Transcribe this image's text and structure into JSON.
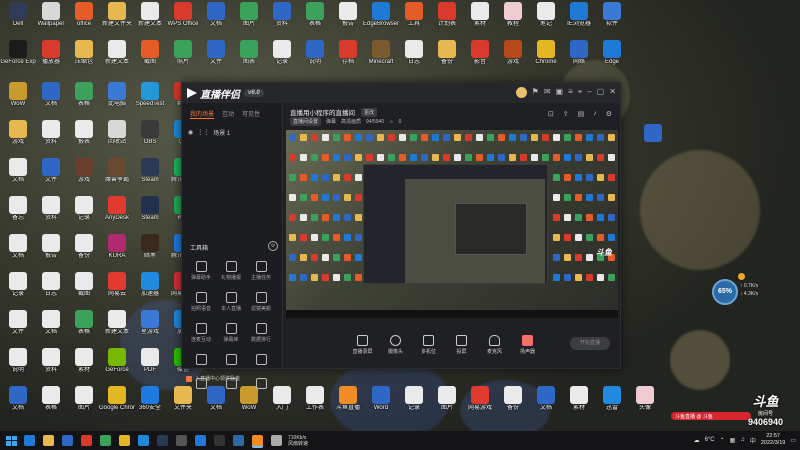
{
  "app": {
    "title_logo": "直播伴侣",
    "version_badge": "v6.0",
    "tabs": [
      "我的场景",
      "互动",
      "可见性"
    ],
    "scene_name": "场景 1",
    "stream_title": "直播用小程序的直播间",
    "stream_tag": "更改",
    "sub_items": [
      "直播间设置",
      "弹幕",
      "高清画质",
      "94/5940",
      "0"
    ],
    "toolbox_title": "工具箱",
    "tools": [
      "弹幕助手",
      "礼物播报",
      "主播任务",
      "拍照语音",
      "本人直播",
      "滤镜美颜",
      "连麦互动",
      "弹幕库",
      "数据排行",
      "",
      "",
      "",
      "",
      "",
      ""
    ],
    "promo_text": "入直播中心领奖励金",
    "controls": [
      "直播录屏",
      "摄像头",
      "多机位",
      "投屏",
      "麦克风",
      "扬声器"
    ],
    "go_live": "开始直播"
  },
  "widget": {
    "percent": "65%",
    "up": "0.7K/s",
    "down": "4.3K/s"
  },
  "watermark": {
    "brand": "斗鱼",
    "roomlabel": "房间号",
    "room_id": "9406940",
    "ticker": "斗鱼直播 @ 斗鱼"
  },
  "taskbar": {
    "speed_line1": "710Kb/s",
    "speed_line2": "风扇转速",
    "temp": "6°C",
    "ime": "中",
    "time": "22:57",
    "date": "2022/3/19"
  },
  "desktop_icons": [
    {
      "label": "Dell",
      "color": "#2f3b57"
    },
    {
      "label": "Wallpaper",
      "color": "#d8d8d8"
    },
    {
      "label": "office",
      "color": "#e55c28"
    },
    {
      "label": "新建文件夹",
      "color": "#e7b84f"
    },
    {
      "label": "新建文本",
      "color": "#eaeaea"
    },
    {
      "label": "WPS Office",
      "color": "#d93a2b"
    },
    {
      "label": "文档",
      "color": "#2e67c5"
    },
    {
      "label": "图片",
      "color": "#3aa25a"
    },
    {
      "label": "资料",
      "color": "#2e67c5"
    },
    {
      "label": "表格",
      "color": "#3aa25a"
    },
    {
      "label": "报告",
      "color": "#eaeaea"
    },
    {
      "label": "EdgeBrowser",
      "color": "#1e7ad6"
    },
    {
      "label": "工具",
      "color": "#e55c28"
    },
    {
      "label": "计划表",
      "color": "#d93a2b"
    },
    {
      "label": "素材",
      "color": "#eaeaea"
    },
    {
      "label": "教程",
      "color": "#f1cbd2"
    },
    {
      "label": "笔记",
      "color": "#eaeaea"
    },
    {
      "label": "IE浏览器",
      "color": "#1e7ad6"
    },
    {
      "label": "软件",
      "color": "#3a79d6"
    },
    {
      "label": "GeForce Exp",
      "color": "#1b1b1b"
    },
    {
      "label": "播放器",
      "color": "#d93a2b"
    },
    {
      "label": "压缩包",
      "color": "#e7b84f"
    },
    {
      "label": "新建文本",
      "color": "#eaeaea"
    },
    {
      "label": "截图",
      "color": "#e55c28"
    },
    {
      "label": "照片",
      "color": "#3aa25a"
    },
    {
      "label": "文件",
      "color": "#2e67c5"
    },
    {
      "label": "图表",
      "color": "#3aa25a"
    },
    {
      "label": "记录",
      "color": "#eaeaea"
    },
    {
      "label": "说明",
      "color": "#2e67c5"
    },
    {
      "label": "存档",
      "color": "#d93a2b"
    },
    {
      "label": "Minecraft",
      "color": "#7a5a2e"
    },
    {
      "label": "日志",
      "color": "#eaeaea"
    },
    {
      "label": "备份",
      "color": "#e7b84f"
    },
    {
      "label": "影音",
      "color": "#d93a2b"
    },
    {
      "label": "游戏",
      "color": "#b8471c"
    },
    {
      "label": "Chrome",
      "color": "#e3b723"
    },
    {
      "label": "网络",
      "color": "#2e67c5"
    },
    {
      "label": "Edge",
      "color": "#1e7ad6"
    },
    {
      "label": "WoW",
      "color": "#c99b2e"
    },
    {
      "label": "文档",
      "color": "#2e67c5"
    },
    {
      "label": "表格",
      "color": "#3aa25a"
    },
    {
      "label": "此电脑",
      "color": "#3a79d6"
    },
    {
      "label": "SpeedTest",
      "color": "#2497d6"
    },
    {
      "label": "群组",
      "color": "#d93a2b"
    },
    {
      "label": "游戏",
      "color": "#e7b84f"
    },
    {
      "label": "资料",
      "color": "#eaeaea"
    },
    {
      "label": "报表",
      "color": "#eaeaea"
    },
    {
      "label": "回收站",
      "color": "#d8d8d8"
    },
    {
      "label": "OBS",
      "color": "#3a3a3a"
    },
    {
      "label": "QQ",
      "color": "#1c8ad8"
    },
    {
      "label": "文档",
      "color": "#eaeaea"
    },
    {
      "label": "文件",
      "color": "#2e67c5"
    },
    {
      "label": "游戏",
      "color": "#6a3f2e"
    },
    {
      "label": "魔兽争霸",
      "color": "#6a4a2e"
    },
    {
      "label": "Steam",
      "color": "#2a3a55"
    },
    {
      "label": "腾讯视频",
      "color": "#1eb35a"
    },
    {
      "label": "备忘",
      "color": "#eaeaea"
    },
    {
      "label": "资料",
      "color": "#eaeaea"
    },
    {
      "label": "记录",
      "color": "#eaeaea"
    },
    {
      "label": "AnyDesk",
      "color": "#e23a2e"
    },
    {
      "label": "Steam",
      "color": "#22324e"
    },
    {
      "label": "视频",
      "color": "#22aa55"
    },
    {
      "label": "文档",
      "color": "#eaeaea"
    },
    {
      "label": "报告",
      "color": "#eaeaea"
    },
    {
      "label": "备份",
      "color": "#eaeaea"
    },
    {
      "label": "KURA",
      "color": "#b02a6d"
    },
    {
      "label": "暗黑",
      "color": "#3a2a1e"
    },
    {
      "label": "腾讯会议",
      "color": "#1f7ae0"
    },
    {
      "label": "记录",
      "color": "#eaeaea"
    },
    {
      "label": "日志",
      "color": "#eaeaea"
    },
    {
      "label": "截图",
      "color": "#eaeaea"
    },
    {
      "label": "网易云",
      "color": "#e23a2e"
    },
    {
      "label": "加速器",
      "color": "#1f8ae0"
    },
    {
      "label": "网易音乐",
      "color": "#d4303a"
    },
    {
      "label": "文件",
      "color": "#eaeaea"
    },
    {
      "label": "文档",
      "color": "#eaeaea"
    },
    {
      "label": "表格",
      "color": "#3aa25a"
    },
    {
      "label": "新建文本",
      "color": "#eaeaea"
    },
    {
      "label": "星游戏",
      "color": "#3a79d6"
    },
    {
      "label": "加速",
      "color": "#1f8ae0"
    },
    {
      "label": "说明",
      "color": "#eaeaea"
    },
    {
      "label": "资料",
      "color": "#eaeaea"
    },
    {
      "label": "素材",
      "color": "#eaeaea"
    },
    {
      "label": "GeForce",
      "color": "#76b900"
    },
    {
      "label": "PDF",
      "color": "#eaeaea"
    },
    {
      "label": "微信",
      "color": "#2dc100"
    },
    {
      "label": "文档",
      "color": "#2e67c5"
    },
    {
      "label": "表格",
      "color": "#eaeaea"
    },
    {
      "label": "图片",
      "color": "#eaeaea"
    },
    {
      "label": "Google Chrome",
      "color": "#e3b723"
    },
    {
      "label": "360安全",
      "color": "#1f7ae0"
    },
    {
      "label": "文件夹",
      "color": "#e7b84f"
    },
    {
      "label": "文档",
      "color": "#2e67c5"
    },
    {
      "label": "WoW",
      "color": "#c99b2e"
    },
    {
      "label": "入门",
      "color": "#eaeaea"
    },
    {
      "label": "工作表",
      "color": "#eaeaea"
    },
    {
      "label": "斗鱼直播",
      "color": "#f28a26"
    },
    {
      "label": "Word",
      "color": "#2e67c5"
    },
    {
      "label": "记录",
      "color": "#eaeaea"
    },
    {
      "label": "图片",
      "color": "#eaeaea"
    },
    {
      "label": "网易游戏",
      "color": "#e23a2e"
    },
    {
      "label": "备份",
      "color": "#eaeaea"
    },
    {
      "label": "文档",
      "color": "#2e67c5"
    },
    {
      "label": "素材",
      "color": "#eaeaea"
    },
    {
      "label": "迅雷",
      "color": "#1f8ae0"
    },
    {
      "label": "头像",
      "color": "#f1cbd2"
    },
    {
      "label": "文档",
      "color": "#eaeaea"
    },
    {
      "label": "斗鱼",
      "color": "#f28a26"
    }
  ]
}
